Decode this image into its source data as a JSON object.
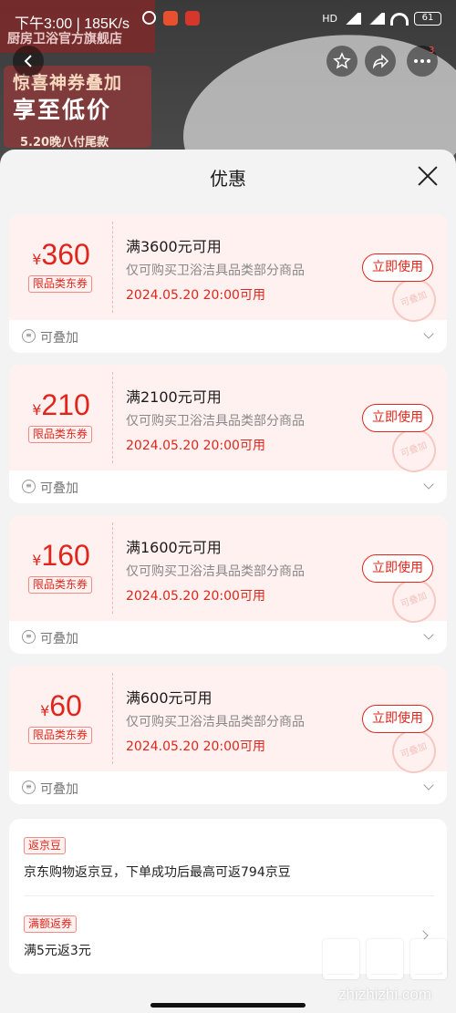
{
  "status_bar": {
    "time": "下午3:00 | 185K/s",
    "network": "HD",
    "battery": "61"
  },
  "background_page": {
    "store_name": "厨房卫浴官方旗舰店",
    "banner_line1": "惊喜神券叠加",
    "banner_line2": "享至低价",
    "banner_line3": "5.20晚八付尾款",
    "more_badge": "3"
  },
  "sheet": {
    "title": "优惠"
  },
  "coupons": [
    {
      "currency": "¥",
      "amount": "360",
      "tag": "限品类东券",
      "title": "满3600元可用",
      "desc": "仅可购买卫浴洁具品类部分商品",
      "time": "2024.05.20 20:00可用",
      "button": "立即使用",
      "stack_label": "可叠加",
      "stamp": "可叠加"
    },
    {
      "currency": "¥",
      "amount": "210",
      "tag": "限品类东券",
      "title": "满2100元可用",
      "desc": "仅可购买卫浴洁具品类部分商品",
      "time": "2024.05.20 20:00可用",
      "button": "立即使用",
      "stack_label": "可叠加",
      "stamp": "可叠加"
    },
    {
      "currency": "¥",
      "amount": "160",
      "tag": "限品类东券",
      "title": "满1600元可用",
      "desc": "仅可购买卫浴洁具品类部分商品",
      "time": "2024.05.20 20:00可用",
      "button": "立即使用",
      "stack_label": "可叠加",
      "stamp": "可叠加"
    },
    {
      "currency": "¥",
      "amount": "60",
      "tag": "限品类东券",
      "title": "满600元可用",
      "desc": "仅可购买卫浴洁具品类部分商品",
      "time": "2024.05.20 20:00可用",
      "button": "立即使用",
      "stack_label": "可叠加",
      "stamp": "可叠加"
    }
  ],
  "extras": {
    "bean_badge": "返京豆",
    "bean_text": "京东购物返京豆，下单成功后最高可返794京豆",
    "rebate_badge": "满额返券",
    "rebate_text": "满5元返3元"
  },
  "watermark": {
    "url": "zhizhizhi.com"
  },
  "colors": {
    "accent": "#e0261c",
    "coupon_bg": "#fff1ef",
    "sheet_bg": "#f3f3f3"
  }
}
